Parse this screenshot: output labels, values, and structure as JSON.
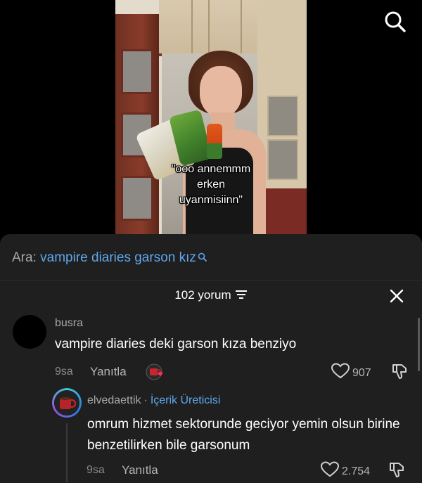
{
  "video": {
    "caption_lines": [
      "\"ooo annemmm",
      "erken",
      "uyanmisiinn\""
    ],
    "search_icon": "search-icon"
  },
  "search": {
    "prefix": "Ara:",
    "query": "vampire diaries garson kız",
    "icon": "search-small-icon"
  },
  "comments_header": {
    "count_label": "102 yorum",
    "filter_icon": "filter-icon",
    "close_icon": "close-icon"
  },
  "comments": [
    {
      "username": "busra",
      "text": "vampire diaries deki garson kıza benziyo",
      "time": "9sa",
      "reply_label": "Yanıtla",
      "likes": "907",
      "creator_reaction_icon": "creator-reaction-icon"
    }
  ],
  "replies": [
    {
      "username": "elvedaettik",
      "separator": "·",
      "badge": "İçerik Üreticisi",
      "text": "omrum hizmet sektorunde geciyor yemin olsun birine benzetilirken bile garsonum",
      "time": "9sa",
      "reply_label": "Yanıtla",
      "likes": "2.754"
    }
  ],
  "colors": {
    "sheet_bg": "#1f1f1f",
    "accent": "#5ea7ec",
    "muted_text": "#a8a8a8"
  }
}
